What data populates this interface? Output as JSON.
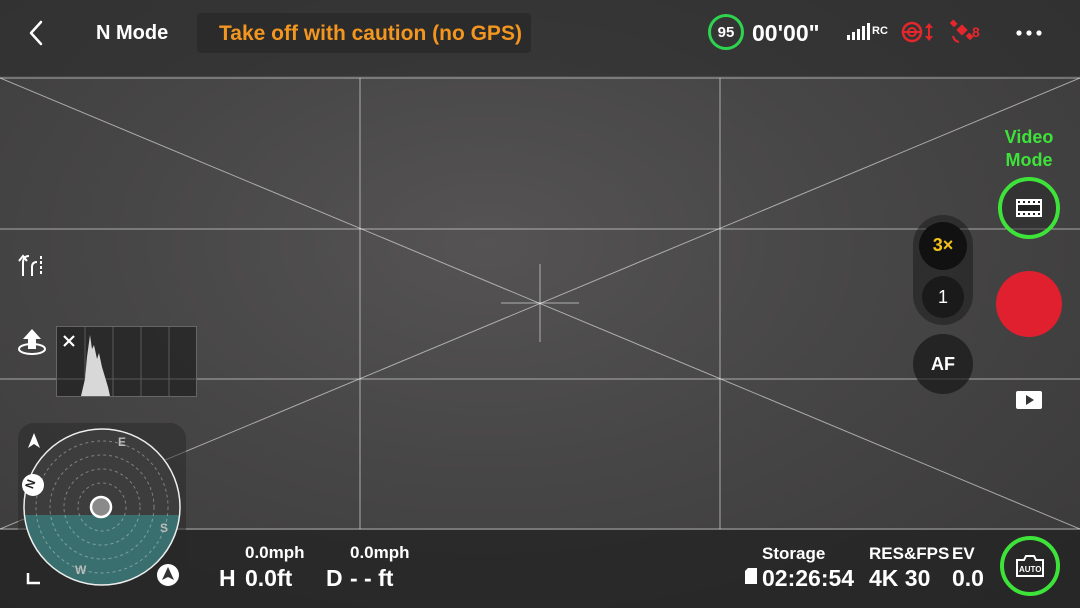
{
  "header": {
    "mode_label": "N Mode",
    "warning_text": "Take off with caution (no GPS)",
    "battery_level": "95",
    "battery_fraction": 0.95,
    "flight_time": "00'00\"",
    "rc_label": "RC",
    "satellite_count": "8"
  },
  "camera": {
    "mode_label_line1": "Video",
    "mode_label_line2": "Mode",
    "zoom_3x_label": "3×",
    "zoom_1x_label": "1",
    "af_label": "AF",
    "auto_label": "AUTO"
  },
  "compass": {
    "north": "N",
    "east": "E",
    "south": "S",
    "west": "W"
  },
  "telemetry": {
    "h_speed": "0.0mph",
    "v_speed": "0.0mph",
    "h_label": "H",
    "h_value": "0.0ft",
    "d_label": "D",
    "d_value": "- - ft"
  },
  "status": {
    "storage_label": "Storage",
    "storage_value": "02:26:54",
    "resfps_label": "RES&FPS",
    "resfps_value": "4K 30",
    "ev_label": "EV",
    "ev_value": "0.0"
  },
  "colors": {
    "accent_green": "#3ee33a",
    "warning_orange": "#f2961f",
    "record_red": "#e0202f",
    "alert_red": "#e5272c",
    "zoom_yellow": "#f4c21a"
  }
}
